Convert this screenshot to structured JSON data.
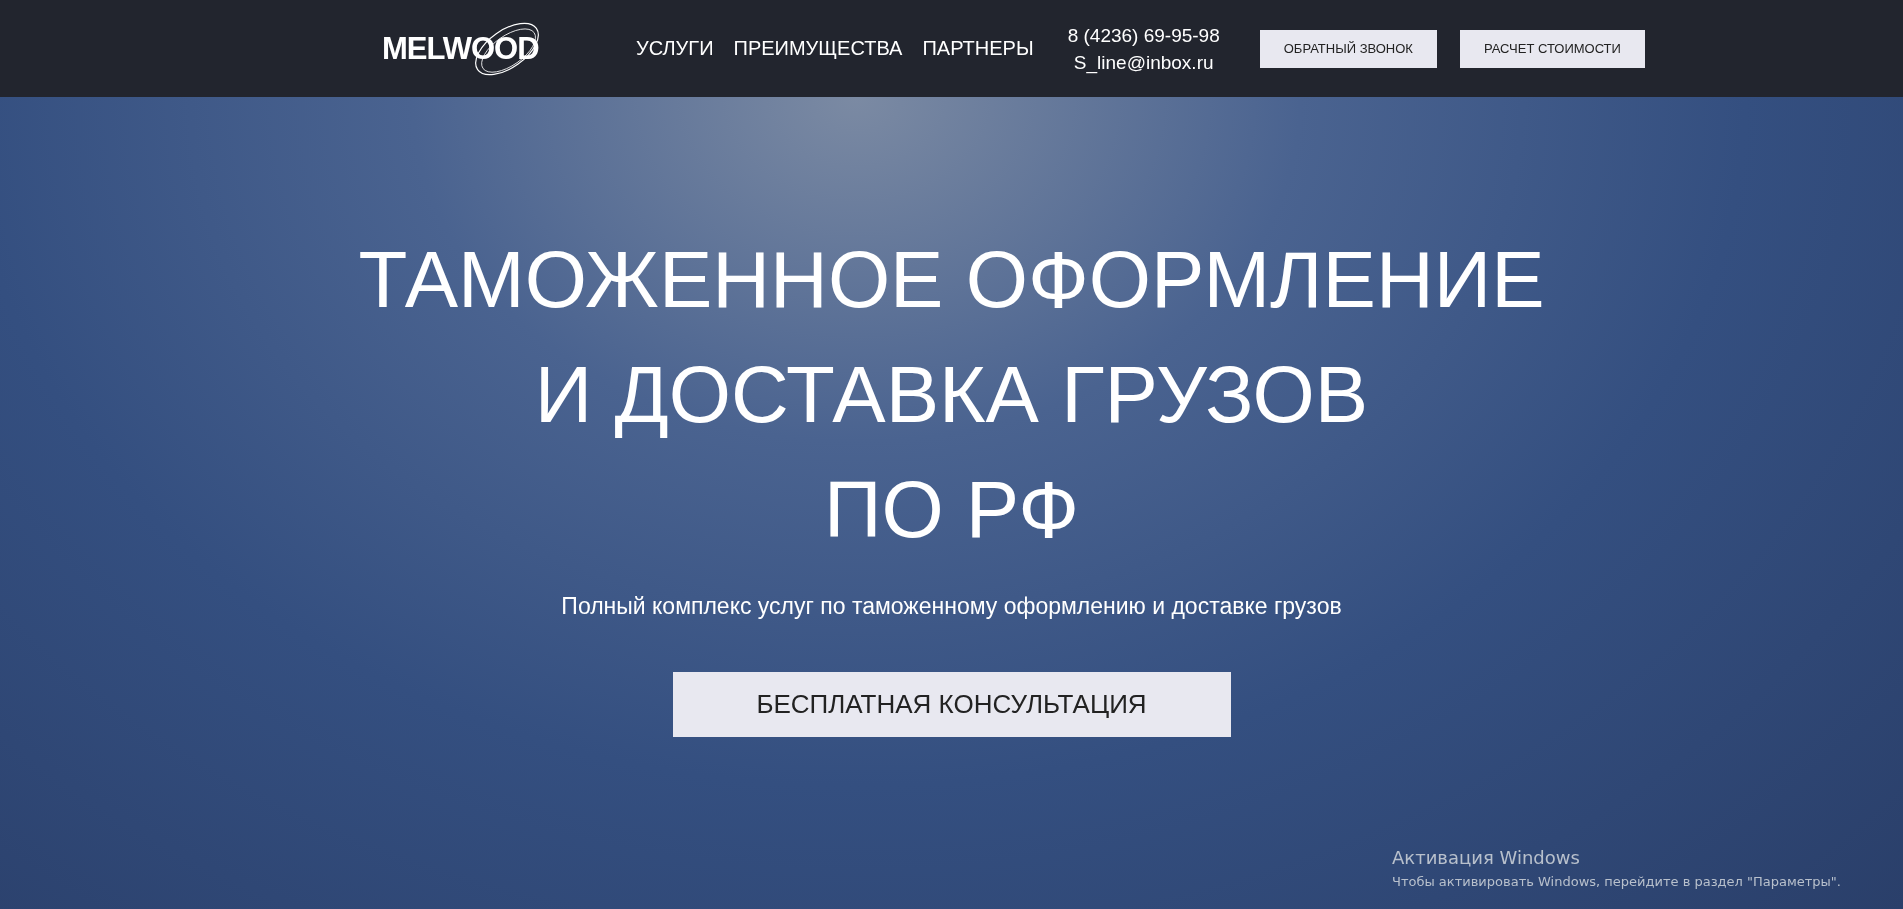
{
  "header": {
    "logo": "MELWOOD",
    "nav": [
      {
        "label": "УСЛУГИ"
      },
      {
        "label": "ПРЕИМУЩЕСТВА"
      },
      {
        "label": "ПАРТНЕРЫ"
      }
    ],
    "phone": "8 (4236) 69-95-98",
    "email": "S_line@inbox.ru",
    "buttons": [
      "ОБРАТНЫЙ ЗВОНОК",
      "РАСЧЕТ СТОИМОСТИ"
    ]
  },
  "hero": {
    "title_lines": [
      "ТАМОЖЕННОЕ ОФОРМЛЕНИЕ",
      "И ДОСТАВКА ГРУЗОВ",
      "ПО РФ"
    ],
    "subtitle": "Полный комплекс услуг по таможенному оформлению и доставке грузов",
    "cta": "БЕСПЛАТНАЯ КОНСУЛЬТАЦИЯ"
  },
  "os_notice": {
    "title": "Активация Windows",
    "text": "Чтобы активировать Windows, перейдите в раздел \"Параметры\"."
  }
}
